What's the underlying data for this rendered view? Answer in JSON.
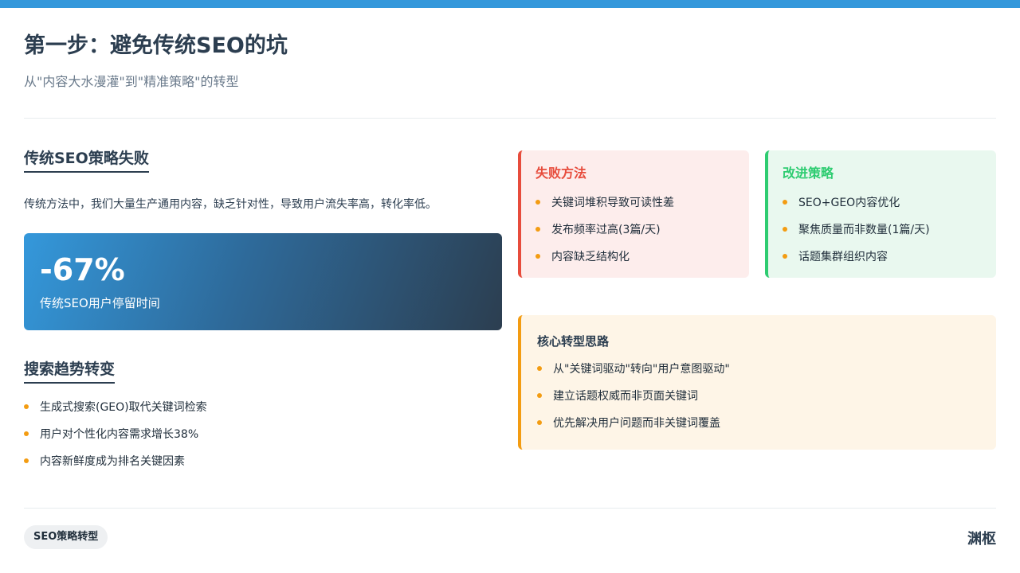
{
  "header": {
    "title": "第一步：避免传统SEO的坑",
    "subtitle": "从\"内容大水漫灌\"到\"精准策略\"的转型"
  },
  "left": {
    "section_title": "传统SEO策略失败",
    "intro": "传统方法中，我们大量生产通用内容，缺乏针对性，导致用户流失率高，转化率低。",
    "stat": {
      "value": "-67%",
      "label": "传统SEO用户停留时间"
    },
    "trend_title": "搜索趋势转变",
    "trend_items": [
      "生成式搜索(GEO)取代关键词检索",
      "用户对个性化内容需求增长38%",
      "内容新鲜度成为排名关键因素"
    ]
  },
  "fail_card": {
    "title": "失败方法",
    "items": [
      "关键词堆积导致可读性差",
      "发布频率过高(3篇/天)",
      "内容缺乏结构化"
    ]
  },
  "improve_card": {
    "title": "改进策略",
    "items": [
      "SEO+GEO内容优化",
      "聚焦质量而非数量(1篇/天)",
      "话题集群组织内容"
    ]
  },
  "core_card": {
    "title": "核心转型思路",
    "items": [
      "从\"关键词驱动\"转向\"用户意图驱动\"",
      "建立话题权威而非页面关键词",
      "优先解决用户问题而非关键词覆盖"
    ]
  },
  "footer": {
    "tag": "SEO策略转型",
    "brand": "渊枢"
  },
  "colors": {
    "accent": "#3498db",
    "fail": "#e74c3c",
    "improve": "#2ecc71",
    "highlight": "#f39c12",
    "dark": "#2c3e50"
  }
}
